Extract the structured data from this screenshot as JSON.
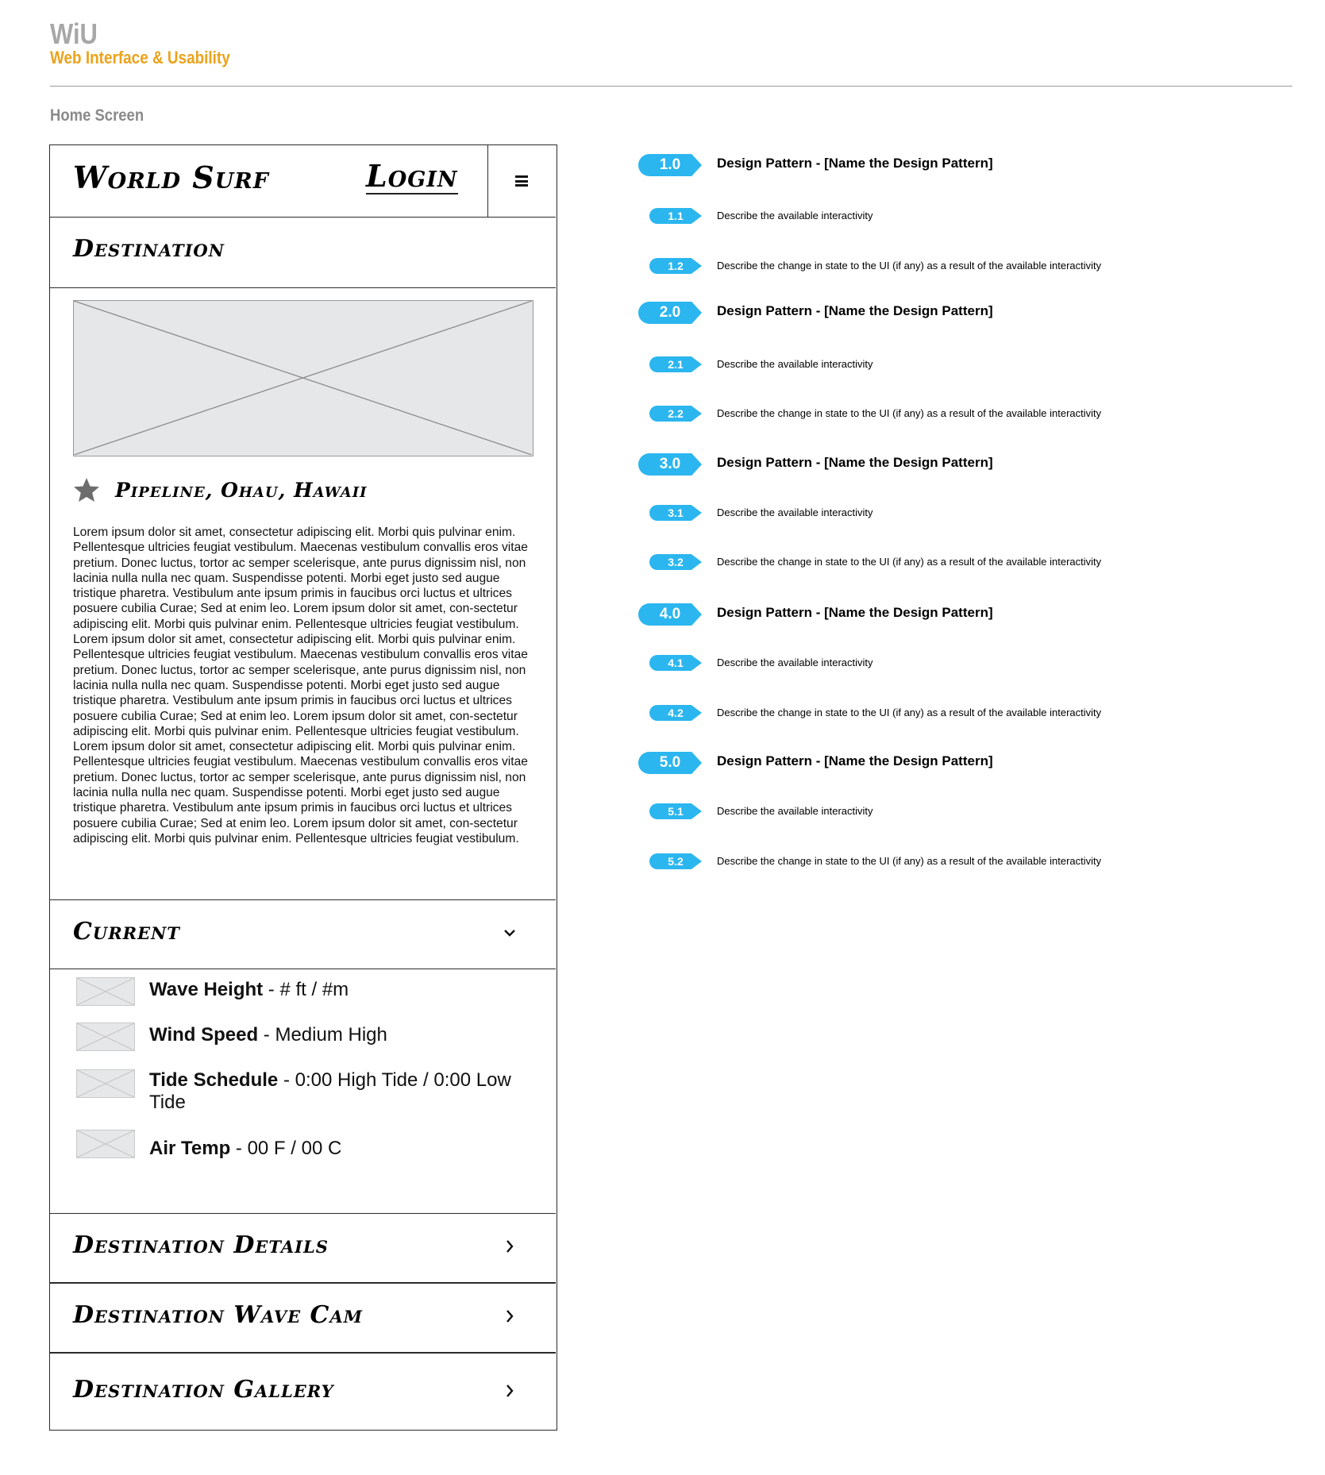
{
  "header": {
    "brand": "WiU",
    "subtitle": "Web Interface & Usability",
    "screen_label": "Home Screen"
  },
  "phone": {
    "logo": "World Surf",
    "login": "Login",
    "menu_icon": "hamburger-menu-icon",
    "destination_label": "Destination",
    "location": "Pipeline, Ohau, Hawaii",
    "paragraphs": [
      "Lorem ipsum dolor sit amet, consectetur adipiscing elit. Morbi quis pulvinar enim. Pellentesque ultricies feugiat vestibulum. Maecenas vestibulum convallis eros vitae pretium. Donec luctus, tortor ac semper scelerisque, ante purus dignissim nisl, non lacinia nulla nulla nec quam. Suspendisse potenti. Morbi eget justo sed augue tristique pharetra. Vestibulum ante ipsum primis in faucibus orci luctus et ultrices posuere cubilia Curae; Sed at enim leo. Lorem ipsum dolor sit amet, con-sectetur adipiscing elit. Morbi quis pulvinar enim. Pellentesque ultricies feugiat vestibulum.",
      "Lorem ipsum dolor sit amet, consectetur adipiscing elit. Morbi quis pulvinar enim. Pellentesque ultricies feugiat vestibulum. Maecenas vestibulum convallis eros vitae pretium. Donec luctus, tortor ac semper scelerisque, ante purus dignissim nisl, non lacinia nulla nulla nec quam. Suspendisse potenti. Morbi eget justo sed augue tristique pharetra. Vestibulum ante ipsum primis in faucibus orci luctus et ultrices posuere cubilia Curae; Sed at enim leo. Lorem ipsum dolor sit amet, con-sectetur adipiscing elit. Morbi quis pulvinar enim. Pellentesque ultricies feugiat vestibulum.",
      "Lorem ipsum dolor sit amet, consectetur adipiscing elit. Morbi quis pulvinar enim. Pellentesque ultricies feugiat vestibulum. Maecenas vestibulum convallis eros vitae pretium. Donec luctus, tortor ac semper scelerisque, ante purus dignissim nisl, non lacinia nulla nulla nec quam. Suspendisse potenti. Morbi eget justo sed augue tristique pharetra. Vestibulum ante ipsum primis in faucibus orci luctus et ultrices posuere cubilia Curae; Sed at enim leo. Lorem ipsum dolor sit amet, con-sectetur adipiscing elit. Morbi quis pulvinar enim. Pellentesque ultricies feugiat vestibulum."
    ],
    "current": {
      "label": "Current",
      "metrics": [
        {
          "name": "Wave Height",
          "value": " - # ft / #m"
        },
        {
          "name": "Wind Speed",
          "value": " - Medium High"
        },
        {
          "name": "Tide Schedule",
          "value": " - 0:00 High Tide / 0:00 Low Tide"
        },
        {
          "name": "Air Temp",
          "value": " - 00 F / 00 C"
        }
      ]
    },
    "sections": [
      {
        "label": "Destination Details"
      },
      {
        "label": "Destination Wave Cam"
      },
      {
        "label": "Destination Gallery"
      }
    ]
  },
  "annotations": [
    {
      "number": "1.0",
      "text": "Design Pattern - [Name the Design Pattern]",
      "level": "major"
    },
    {
      "number": "1.1",
      "text": "Describe the available interactivity",
      "level": "minor"
    },
    {
      "number": "1.2",
      "text": "Describe the change in state to the UI (if any) as a result of the available interactivity",
      "level": "minor"
    },
    {
      "number": "2.0",
      "text": "Design Pattern - [Name the Design Pattern]",
      "level": "major"
    },
    {
      "number": "2.1",
      "text": "Describe the available interactivity",
      "level": "minor"
    },
    {
      "number": "2.2",
      "text": "Describe the change in state to the UI (if any) as a result of the available interactivity",
      "level": "minor"
    },
    {
      "number": "3.0",
      "text": "Design Pattern - [Name the Design Pattern]",
      "level": "major"
    },
    {
      "number": "3.1",
      "text": "Describe the available interactivity",
      "level": "minor"
    },
    {
      "number": "3.2",
      "text": "Describe the change in state to the UI (if any) as a result of the available interactivity",
      "level": "minor"
    },
    {
      "number": "4.0",
      "text": "Design Pattern - [Name the Design Pattern]",
      "level": "major"
    },
    {
      "number": "4.1",
      "text": "Describe the available interactivity",
      "level": "minor"
    },
    {
      "number": "4.2",
      "text": "Describe the change in state to the UI (if any) as a result of the available interactivity",
      "level": "minor"
    },
    {
      "number": "5.0",
      "text": "Design Pattern - [Name the Design Pattern]",
      "level": "major"
    },
    {
      "number": "5.1",
      "text": "Describe the available interactivity",
      "level": "minor"
    },
    {
      "number": "5.2",
      "text": "Describe the change in state to the UI (if any) as a result of the available interactivity",
      "level": "minor"
    }
  ],
  "colors": {
    "brand_gray": "#a7a7a7",
    "brand_orange": "#eba21b",
    "badge_blue": "#2bb6ef",
    "placeholder_gray": "#e6e7e8"
  }
}
